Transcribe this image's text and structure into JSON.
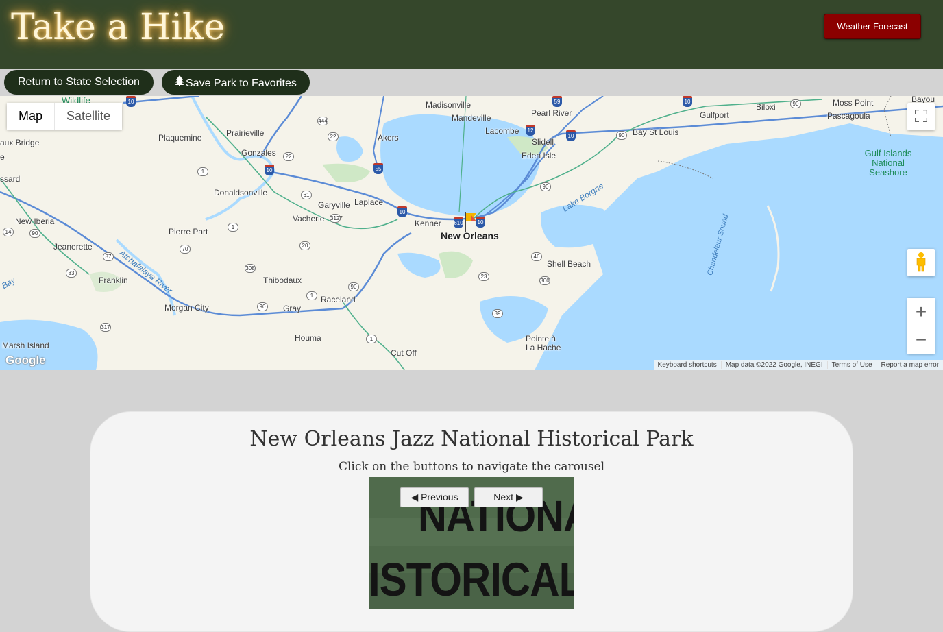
{
  "header": {
    "title": "Take a Hike",
    "weather_button": "Weather Forecast"
  },
  "actions": {
    "return_label": "Return to State Selection",
    "save_label": "Save Park to Favorites",
    "save_icon": "tree-icon"
  },
  "map": {
    "type_options": [
      "Map",
      "Satellite"
    ],
    "selected_type": "Map",
    "labels": [
      "Madisonville",
      "Mandeville",
      "Pearl River",
      "Lacombe",
      "Slidell",
      "Eden Isle",
      "Bay St Louis",
      "Biloxi",
      "Gulfport",
      "Moss Point",
      "Pascagoula",
      "Bayou",
      "Prairieville",
      "Plaquemine",
      "Gonzales",
      "Akers",
      "Donaldsonville",
      "Garyville",
      "Laplace",
      "Vacherie",
      "Kenner",
      "New Orleans",
      "Lake Borgne",
      "Chandeleur Sound",
      "Gulf Islands National Seashore",
      "Shell Beach",
      "Pierre Part",
      "New Iberia",
      "Jeanerette",
      "Franklin",
      "Atchafalaya River",
      "Thibodaux",
      "Raceland",
      "Morgan City",
      "Gray",
      "Houma",
      "Pointe à La Hache",
      "Cut Off",
      "Marsh Island",
      "aux Bridge",
      "ssard",
      "e",
      "Bay",
      "Wildlife"
    ],
    "attribution": [
      "Keyboard shortcuts",
      "Map data ©2022 Google, INEGI",
      "Terms of Use",
      "Report a map error"
    ],
    "logo": "Google",
    "controls": [
      "fullscreen-icon",
      "pegman-icon",
      "zoom-in-icon",
      "zoom-out-icon"
    ],
    "marker": "flag-marker-icon"
  },
  "park": {
    "name": "New Orleans Jazz National Historical Park",
    "instructions": "Click on the buttons to navigate the carousel",
    "prev_label": "◀ Previous",
    "next_label": "Next ▶",
    "photo_text_1": "NATIONA",
    "photo_text_2": "ISTORICAL"
  },
  "colors": {
    "header_bg": "#35472b",
    "weather_bg": "#8b0000",
    "pill_bg": "#1f2f1a",
    "page_bg": "#d3d3d3",
    "card_bg": "#f4f4f4"
  }
}
